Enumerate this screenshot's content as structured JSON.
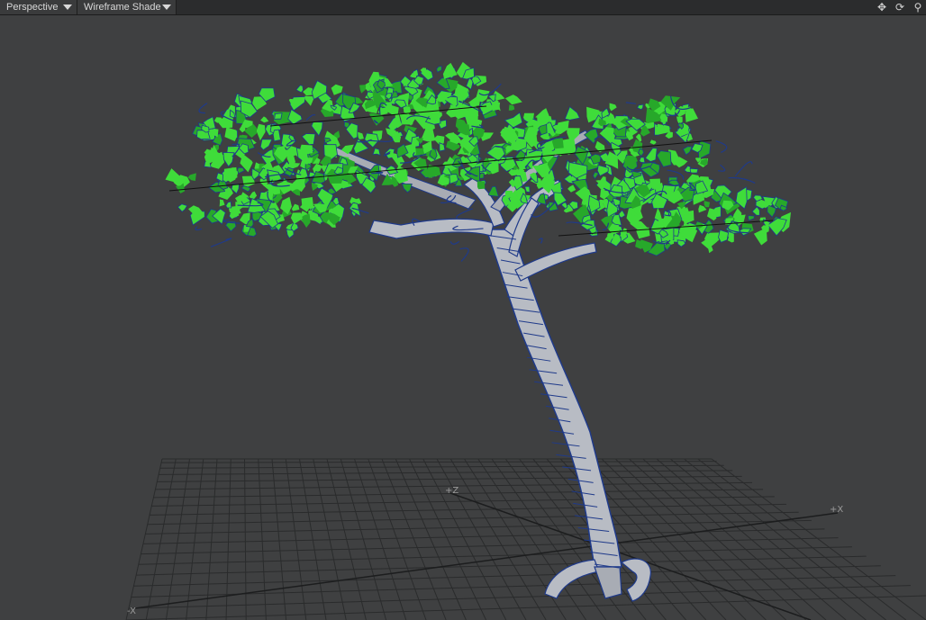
{
  "toolbar": {
    "view_mode": "Perspective",
    "shading_mode": "Wireframe Shade",
    "icons": [
      "move-view-icon",
      "rotate-view-icon",
      "zoom-view-icon"
    ]
  },
  "viewport": {
    "axis_labels": {
      "z": "+Z",
      "x_pos": "+X",
      "x_neg": "-X"
    },
    "colors": {
      "background": "#3f4041",
      "grid": "#2a2b2c",
      "foliage": "#3fdc3a",
      "foliage_dark": "#27a82a",
      "wire": "#1f3a8a",
      "trunk": "#b8bcc4"
    }
  }
}
